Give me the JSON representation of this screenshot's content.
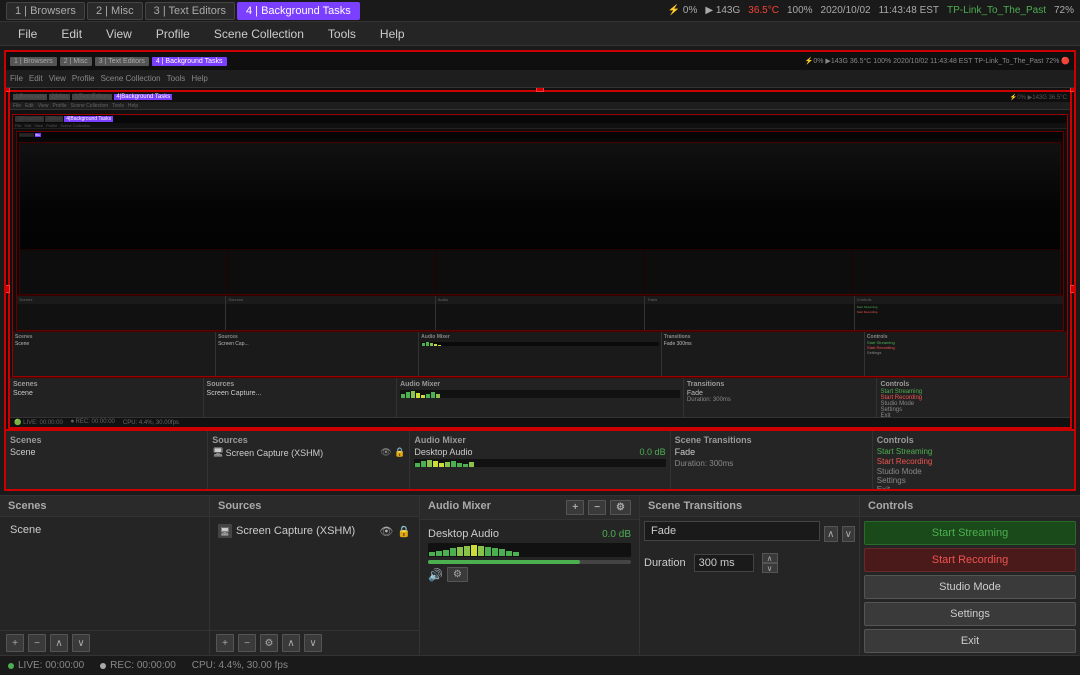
{
  "systemBar": {
    "tabs": [
      {
        "label": "1 | Browsers",
        "active": false
      },
      {
        "label": "2 | Misc",
        "active": false
      },
      {
        "label": "3 | Text Editors",
        "active": false
      },
      {
        "label": "4 | Background Tasks",
        "active": true
      }
    ],
    "stats": {
      "cpu": "⚡ 0%",
      "ram": "▶ 143G",
      "temp": "36.5°C",
      "battery": "100%",
      "date": "2020/10/02",
      "time": "11:43:48 EST",
      "network": "TP-Link_To_The_Past",
      "brightness": "72%"
    }
  },
  "menuBar": {
    "items": [
      "File",
      "Edit",
      "View",
      "Profile",
      "Scene Collection",
      "Tools",
      "Help"
    ]
  },
  "panels": {
    "scenes": {
      "title": "Scenes",
      "items": [
        "Scene"
      ]
    },
    "sources": {
      "title": "Sources",
      "items": [
        {
          "label": "Screen Capture (XSHM)",
          "visible": true,
          "locked": true
        }
      ]
    },
    "audioMixer": {
      "title": "Audio Mixer",
      "tracks": [
        {
          "name": "Desktop Audio",
          "volume": "0.0 dB",
          "levels": [
            8,
            10,
            12,
            15,
            18,
            20,
            22,
            20,
            18,
            15,
            12,
            10,
            8,
            6,
            8,
            10,
            12,
            14,
            16,
            14
          ],
          "sliderPos": 75
        }
      ]
    },
    "sceneTransitions": {
      "title": "Scene Transitions",
      "type": "Fade",
      "duration": "300 ms",
      "durationLabel": "Duration"
    },
    "controls": {
      "title": "Controls",
      "buttons": [
        {
          "label": "Start Streaming",
          "type": "streaming"
        },
        {
          "label": "Start Recording",
          "type": "recording"
        },
        {
          "label": "Studio Mode",
          "type": "normal"
        },
        {
          "label": "Settings",
          "type": "normal"
        },
        {
          "label": "Exit",
          "type": "normal"
        }
      ]
    }
  },
  "statusBar": {
    "live": "LIVE: 00:00:00",
    "rec": "REC: 00:00:00",
    "cpu": "CPU: 4.4%, 30.00 fps"
  },
  "preview": {
    "innerSysBar": {
      "tabs": [
        "1 | Browsers",
        "2 | Misc",
        "3 | Text Editors",
        "4 | Background Tasks"
      ]
    },
    "innerMenuBar": [
      "File",
      "Edit",
      "View",
      "Profile",
      "Scene Collection",
      "Tools",
      "Help"
    ]
  }
}
